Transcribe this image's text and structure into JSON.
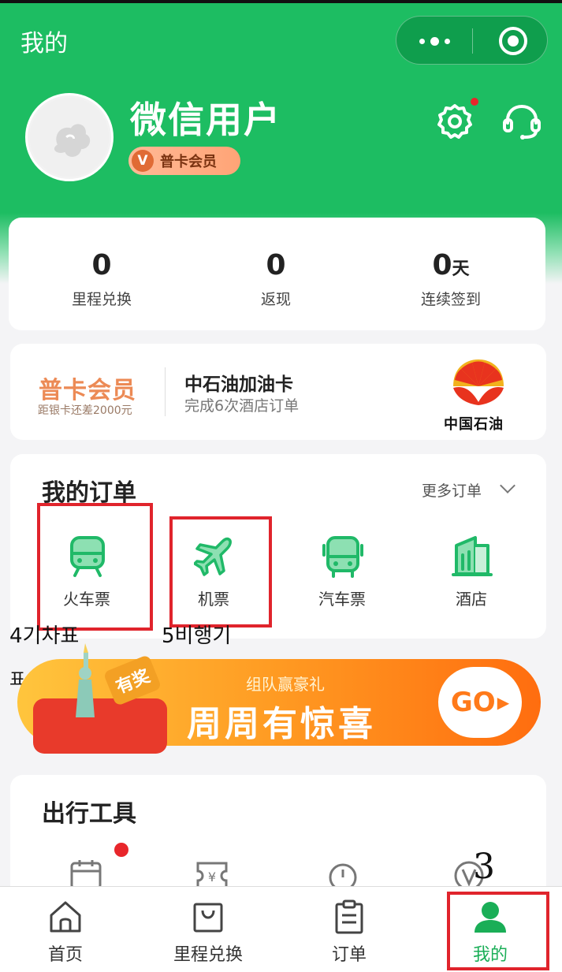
{
  "header": {
    "title": "我的",
    "capsule": {
      "more_icon": "more-dots-icon",
      "close_icon": "target-close-icon"
    }
  },
  "profile": {
    "username": "微信用户",
    "member_level": "普卡会员",
    "member_badge_letter": "V",
    "settings_icon": "gear-icon",
    "settings_has_dot": true,
    "support_icon": "headset-icon"
  },
  "stats": [
    {
      "value": "0",
      "unit": "",
      "label": "里程兑换"
    },
    {
      "value": "0",
      "unit": "",
      "label": "返现"
    },
    {
      "value": "0",
      "unit": "天",
      "label": "连续签到"
    }
  ],
  "promo": {
    "vip_title": "普卡会员",
    "vip_subtitle": "距银卡还差2000元",
    "reward_title": "中石油加油卡",
    "reward_subtitle": "完成6次酒店订单",
    "brand_name": "中国石油"
  },
  "orders": {
    "title": "我的订单",
    "more_label": "更多订单",
    "items": [
      {
        "label": "火车票",
        "icon": "train-icon"
      },
      {
        "label": "机票",
        "icon": "plane-icon"
      },
      {
        "label": "汽车票",
        "icon": "bus-icon"
      },
      {
        "label": "酒店",
        "icon": "hotel-icon"
      }
    ]
  },
  "annotations": {
    "train_note": "4기차표",
    "train_note_line2": "표",
    "plane_note": "5비행기",
    "tab_note": "3"
  },
  "banner": {
    "tag": "有奖",
    "subtitle": "组队赢豪礼",
    "title": "周周有惊喜",
    "button": "GO"
  },
  "tools": {
    "title": "出行工具",
    "icons": [
      "calendar-icon",
      "ticket-yen-icon",
      "timer-icon",
      "vip-icon"
    ]
  },
  "tabbar": [
    {
      "label": "首页",
      "icon": "home-icon",
      "active": false
    },
    {
      "label": "里程兑换",
      "icon": "shopping-bag-icon",
      "active": false
    },
    {
      "label": "订单",
      "icon": "clipboard-icon",
      "active": false
    },
    {
      "label": "我的",
      "icon": "person-icon",
      "active": true
    }
  ],
  "colors": {
    "primary": "#1dbd62",
    "highlight": "#e0242c",
    "banner_orange": "#ff8a1e",
    "active_tab": "#1aae57"
  }
}
